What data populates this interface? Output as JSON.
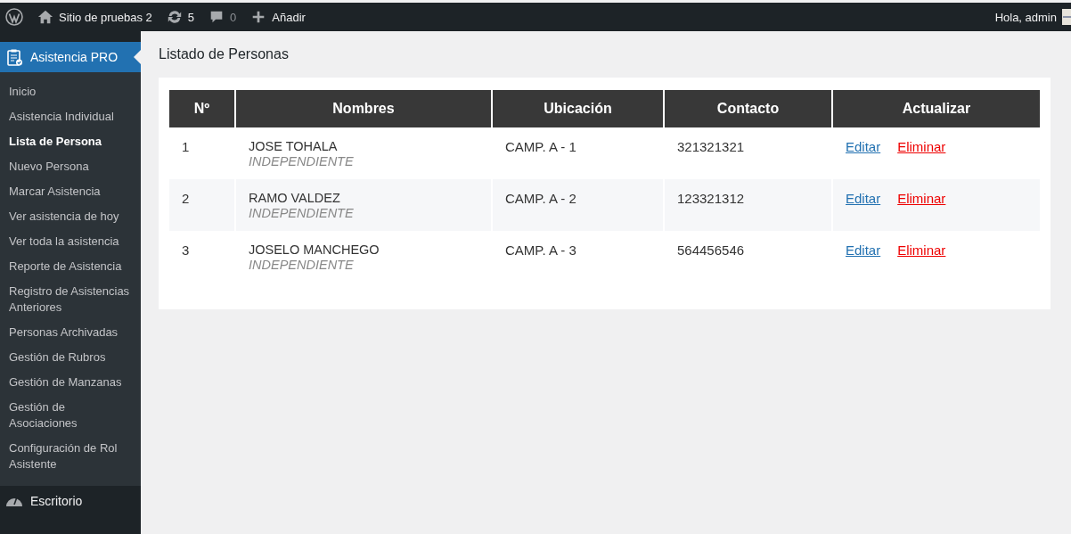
{
  "top_bar": {
    "site_name": "Sitio de pruebas 2",
    "updates": "5",
    "comments": "0",
    "add_new": "Añadir",
    "greeting": "Hola, admin"
  },
  "sidebar": {
    "menu": {
      "label": "Asistencia PRO",
      "selected": true
    },
    "items": [
      {
        "label": "Inicio",
        "selected": false
      },
      {
        "label": "Asistencia Individual",
        "selected": false
      },
      {
        "label": "Lista de Persona",
        "selected": true
      },
      {
        "label": "Nuevo Persona",
        "selected": false
      },
      {
        "label": "Marcar Asistencia",
        "selected": false
      },
      {
        "label": "Ver asistencia de hoy",
        "selected": false
      },
      {
        "label": "Ver toda la asistencia",
        "selected": false
      },
      {
        "label": "Reporte de Asistencia",
        "selected": false
      },
      {
        "label": "Registro de Asistencias Anteriores",
        "selected": false
      },
      {
        "label": "Personas Archivadas",
        "selected": false
      },
      {
        "label": "Gestión de Rubros",
        "selected": false
      },
      {
        "label": "Gestión de Manzanas",
        "selected": false
      },
      {
        "label": "Gestión de Asociaciones",
        "selected": false
      },
      {
        "label": "Configuración de Rol Asistente",
        "selected": false
      }
    ],
    "bottom_menu": {
      "label": "Escritorio",
      "selected": false
    }
  },
  "page": {
    "title": "Listado de Personas"
  },
  "table": {
    "columns": [
      "Nº",
      "Nombres",
      "Ubicación",
      "Contacto",
      "Actualizar"
    ],
    "rows": [
      {
        "number": "1",
        "name": "JOSE TOHALA",
        "category": "INDEPENDIENTE",
        "location": "CAMP. A - 1",
        "contact": "321321321",
        "edit": "Editar",
        "delete": "Eliminar"
      },
      {
        "number": "2",
        "name": "RAMO VALDEZ",
        "category": "INDEPENDIENTE",
        "location": "CAMP. A - 2",
        "contact": "123321312",
        "edit": "Editar",
        "delete": "Eliminar"
      },
      {
        "number": "3",
        "name": "JOSELO MANCHEGO",
        "category": "INDEPENDIENTE",
        "location": "CAMP. A - 3",
        "contact": "564456546",
        "edit": "Editar",
        "delete": "Eliminar"
      }
    ]
  }
}
